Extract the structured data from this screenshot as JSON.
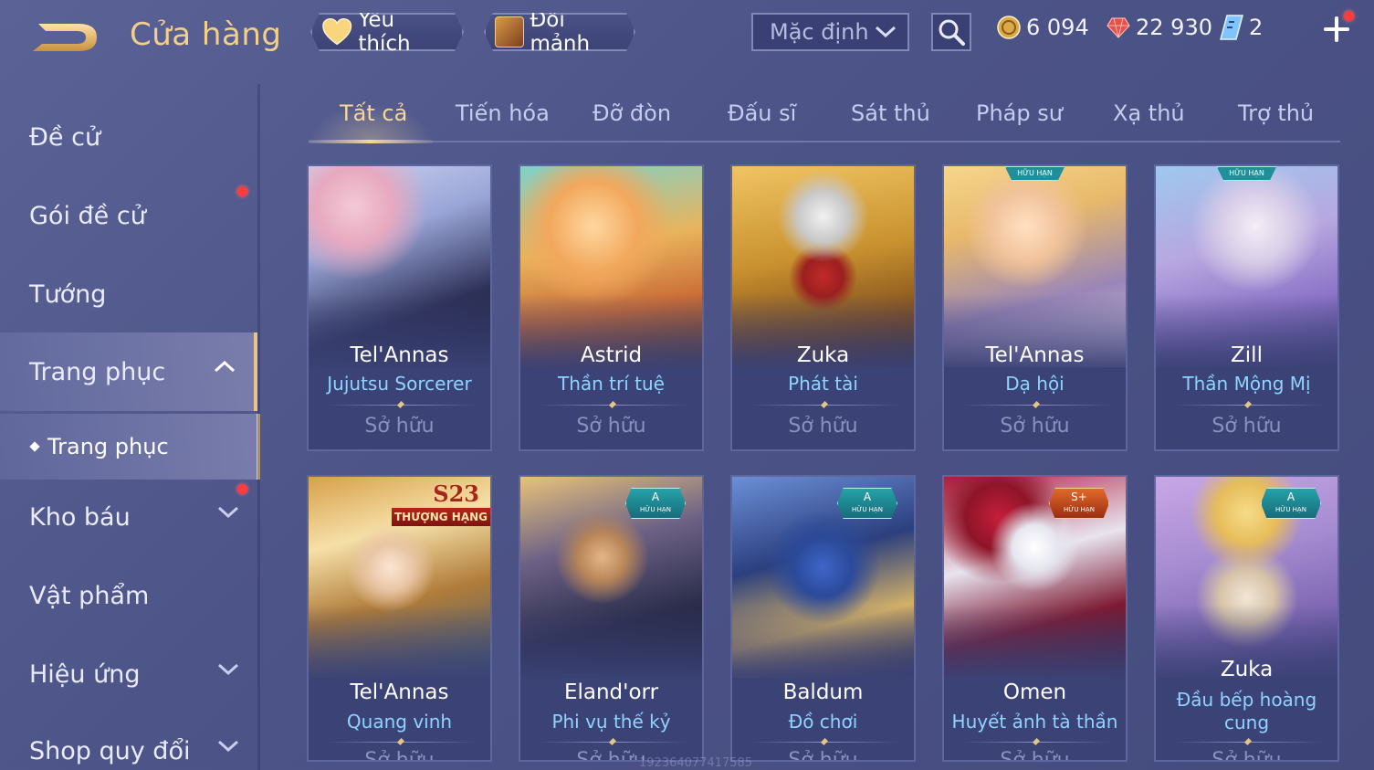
{
  "header": {
    "title": "Cửa hàng",
    "favorites_label": "Yêu thích",
    "shard_exchange_label": "Đổi mảnh",
    "sort": {
      "selected": "Mặc định"
    },
    "currencies": [
      {
        "icon": "gold-coin-icon",
        "value": "6 094"
      },
      {
        "icon": "ruby-gem-icon",
        "value": "22 930"
      },
      {
        "icon": "voucher-icon",
        "value": "2"
      }
    ]
  },
  "sidebar": {
    "items": [
      {
        "label": "Đề cử"
      },
      {
        "label": "Gói đề cử"
      },
      {
        "label": "Tướng"
      },
      {
        "label": "Trang phục"
      },
      {
        "label": "Kho báu"
      },
      {
        "label": "Vật phẩm"
      },
      {
        "label": "Hiệu ứng"
      },
      {
        "label": "Shop quy đổi"
      }
    ],
    "sub_item": {
      "label": "Trang phục"
    }
  },
  "tabs": [
    {
      "label": "Tất cả"
    },
    {
      "label": "Tiến hóa"
    },
    {
      "label": "Đỡ đòn"
    },
    {
      "label": "Đấu sĩ"
    },
    {
      "label": "Sát thủ"
    },
    {
      "label": "Pháp sư"
    },
    {
      "label": "Xạ thủ"
    },
    {
      "label": "Trợ thủ"
    }
  ],
  "cards": [
    {
      "hero": "Tel'Annas",
      "skin": "Jujutsu Sorcerer",
      "status": "Sở hữu",
      "badge": ""
    },
    {
      "hero": "Astrid",
      "skin": "Thần trí tuệ",
      "status": "Sở hữu",
      "badge": ""
    },
    {
      "hero": "Zuka",
      "skin": "Phát tài",
      "status": "Sở hữu",
      "badge": ""
    },
    {
      "hero": "Tel'Annas",
      "skin": "Dạ hội",
      "status": "Sở hữu",
      "badge": "HỮU HẠN"
    },
    {
      "hero": "Zill",
      "skin": "Thần Mộng Mị",
      "status": "Sở hữu",
      "badge": "HỮU HẠN"
    },
    {
      "hero": "Tel'Annas",
      "skin": "Quang vinh",
      "status": "Sở hữu",
      "badge_season": "S23",
      "badge_season_label": "THƯỢNG HẠNG"
    },
    {
      "hero": "Eland'orr",
      "skin": "Phi vụ thế kỷ",
      "status": "Sở hữu",
      "tier": "A",
      "tier_label": "HỮU HẠN"
    },
    {
      "hero": "Baldum",
      "skin": "Đồ chơi",
      "status": "Sở hữu",
      "tier": "A",
      "tier_label": "HỮU HẠN"
    },
    {
      "hero": "Omen",
      "skin": "Huyết ảnh tà thần",
      "status": "Sở hữu",
      "tier": "S+",
      "tier_label": "HỮU HẠN"
    },
    {
      "hero": "Zuka",
      "skin": "Đầu bếp hoàng cung",
      "status": "Sở hữu",
      "tier": "A",
      "tier_label": "HỮU HẠN"
    }
  ],
  "watermark": "1923640774175​85",
  "colors": {
    "background": "#4d5488",
    "title_gold": "#f4cf8a",
    "skin_name_blue": "#8fd3ff",
    "notification_red": "#ff3b3b"
  }
}
